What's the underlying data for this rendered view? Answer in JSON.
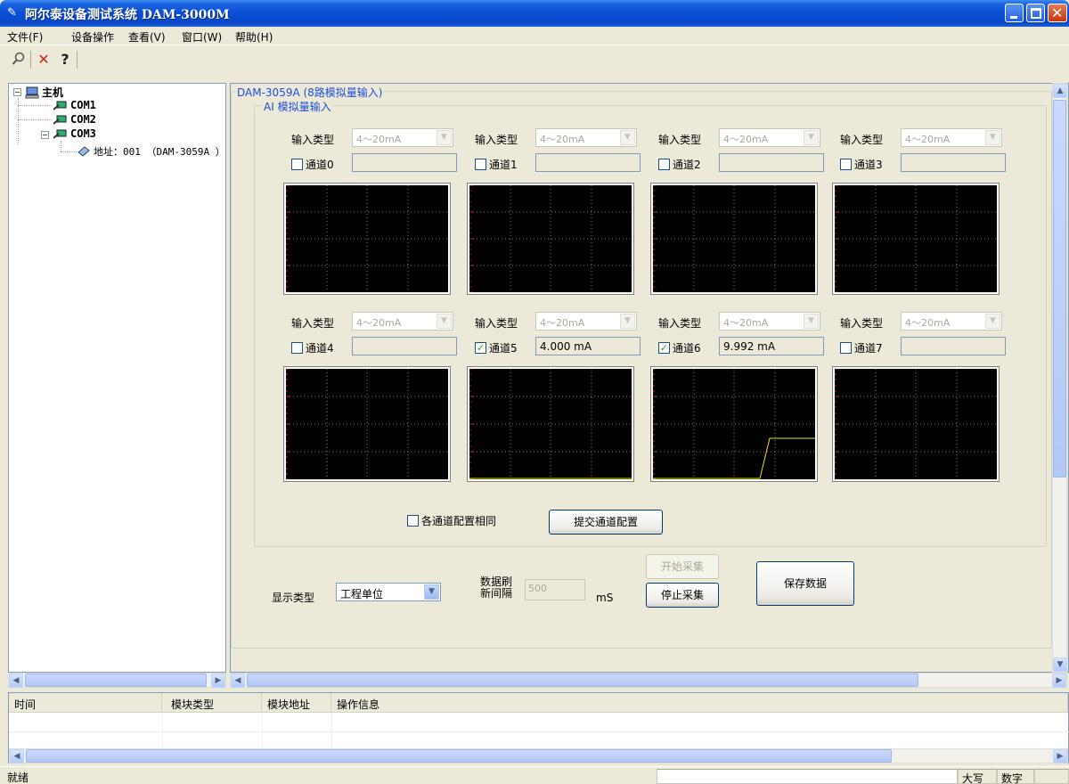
{
  "window": {
    "title": "阿尔泰设备测试系统 DAM-3000M"
  },
  "menu": {
    "items": [
      "文件(F)",
      "设备操作",
      "查看(V)",
      "窗口(W)",
      "帮助(H)"
    ]
  },
  "toolbar": {
    "buttons": [
      "search-icon",
      "close-icon",
      "help-icon"
    ]
  },
  "tree": {
    "root": "主机",
    "com1": "COM1",
    "com2": "COM2",
    "com3": "COM3",
    "device": "地址：001 （DAM-3059A ）"
  },
  "main": {
    "group_title": "DAM-3059A (8路模拟量输入)",
    "ai_title": "AI 模拟量输入",
    "input_type_label": "输入类型",
    "channels": [
      {
        "label": "通道0",
        "type": "4～20mA",
        "checked": false,
        "value": ""
      },
      {
        "label": "通道1",
        "type": "4～20mA",
        "checked": false,
        "value": ""
      },
      {
        "label": "通道2",
        "type": "4～20mA",
        "checked": false,
        "value": ""
      },
      {
        "label": "通道3",
        "type": "4～20mA",
        "checked": false,
        "value": ""
      },
      {
        "label": "通道4",
        "type": "4～20mA",
        "checked": false,
        "value": ""
      },
      {
        "label": "通道5",
        "type": "4～20mA",
        "checked": true,
        "value": "4.000 mA"
      },
      {
        "label": "通道6",
        "type": "4～20mA",
        "checked": true,
        "value": "9.992 mA"
      },
      {
        "label": "通道7",
        "type": "4～20mA",
        "checked": false,
        "value": ""
      }
    ],
    "same_config_label": "各通道配置相同",
    "submit_button": "提交通道配置",
    "display_type_label": "显示类型",
    "display_type_value": "工程单位",
    "refresh_label_1": "数据刷",
    "refresh_label_2": "新间隔",
    "refresh_value": "500",
    "refresh_unit": "mS",
    "start_button": "开始采集",
    "stop_button": "停止采集",
    "save_button": "保存数据"
  },
  "log": {
    "columns": [
      "时间",
      "模块类型",
      "模块地址",
      "操作信息"
    ]
  },
  "status": {
    "ready": "就绪",
    "caps": "大写",
    "num": "数字"
  },
  "colors": {
    "trace": "#f0e000",
    "accent": "#1c4ed6"
  }
}
